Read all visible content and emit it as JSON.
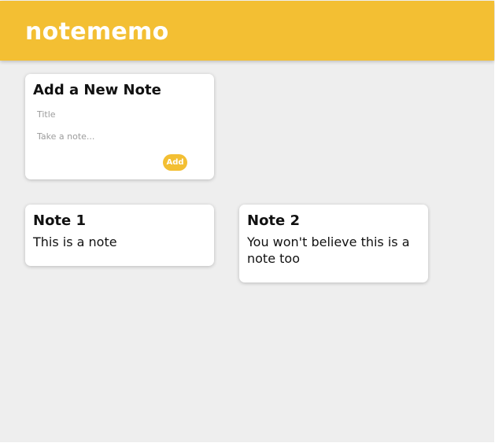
{
  "header": {
    "brand": "notememo"
  },
  "create_note": {
    "heading": "Add a New Note",
    "title_placeholder": "Title",
    "title_value": "",
    "content_placeholder": "Take a note...",
    "content_value": "",
    "add_label": "Add"
  },
  "notes": [
    {
      "title": "Note 1",
      "content": "This is a note"
    },
    {
      "title": "Note 2",
      "content": "You won't believe this is a note too"
    }
  ],
  "colors": {
    "accent": "#f3bf33",
    "background": "#eeeeee",
    "card": "#ffffff"
  }
}
